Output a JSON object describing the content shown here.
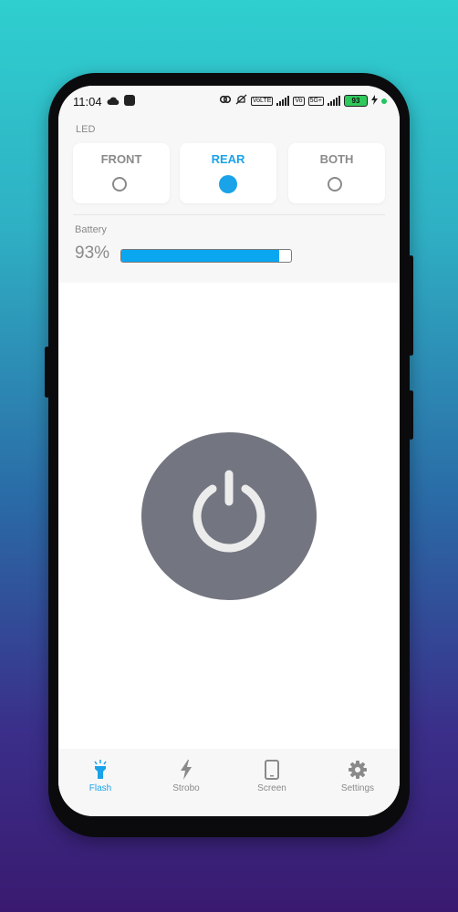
{
  "status_bar": {
    "time": "11:04",
    "battery": "93",
    "network_badge_1": "VoLTE",
    "network_badge_2": "5G+"
  },
  "led": {
    "label": "LED",
    "options": [
      {
        "label": "FRONT",
        "selected": false
      },
      {
        "label": "REAR",
        "selected": true
      },
      {
        "label": "BOTH",
        "selected": false
      }
    ]
  },
  "battery": {
    "label": "Battery",
    "percent_text": "93%",
    "level": 0.93
  },
  "power": {
    "state": "off"
  },
  "bottom_nav": {
    "items": [
      {
        "label": "Flash",
        "icon": "flashlight-icon",
        "active": true
      },
      {
        "label": "Strobo",
        "icon": "lightning-icon",
        "active": false
      },
      {
        "label": "Screen",
        "icon": "phone-screen-icon",
        "active": false
      },
      {
        "label": "Settings",
        "icon": "gear-icon",
        "active": false
      }
    ]
  },
  "colors": {
    "accent": "#1aa3e8",
    "battery_fill": "#0aa6f0",
    "power_button": "#737680",
    "inactive_text": "#8a8a8a"
  }
}
